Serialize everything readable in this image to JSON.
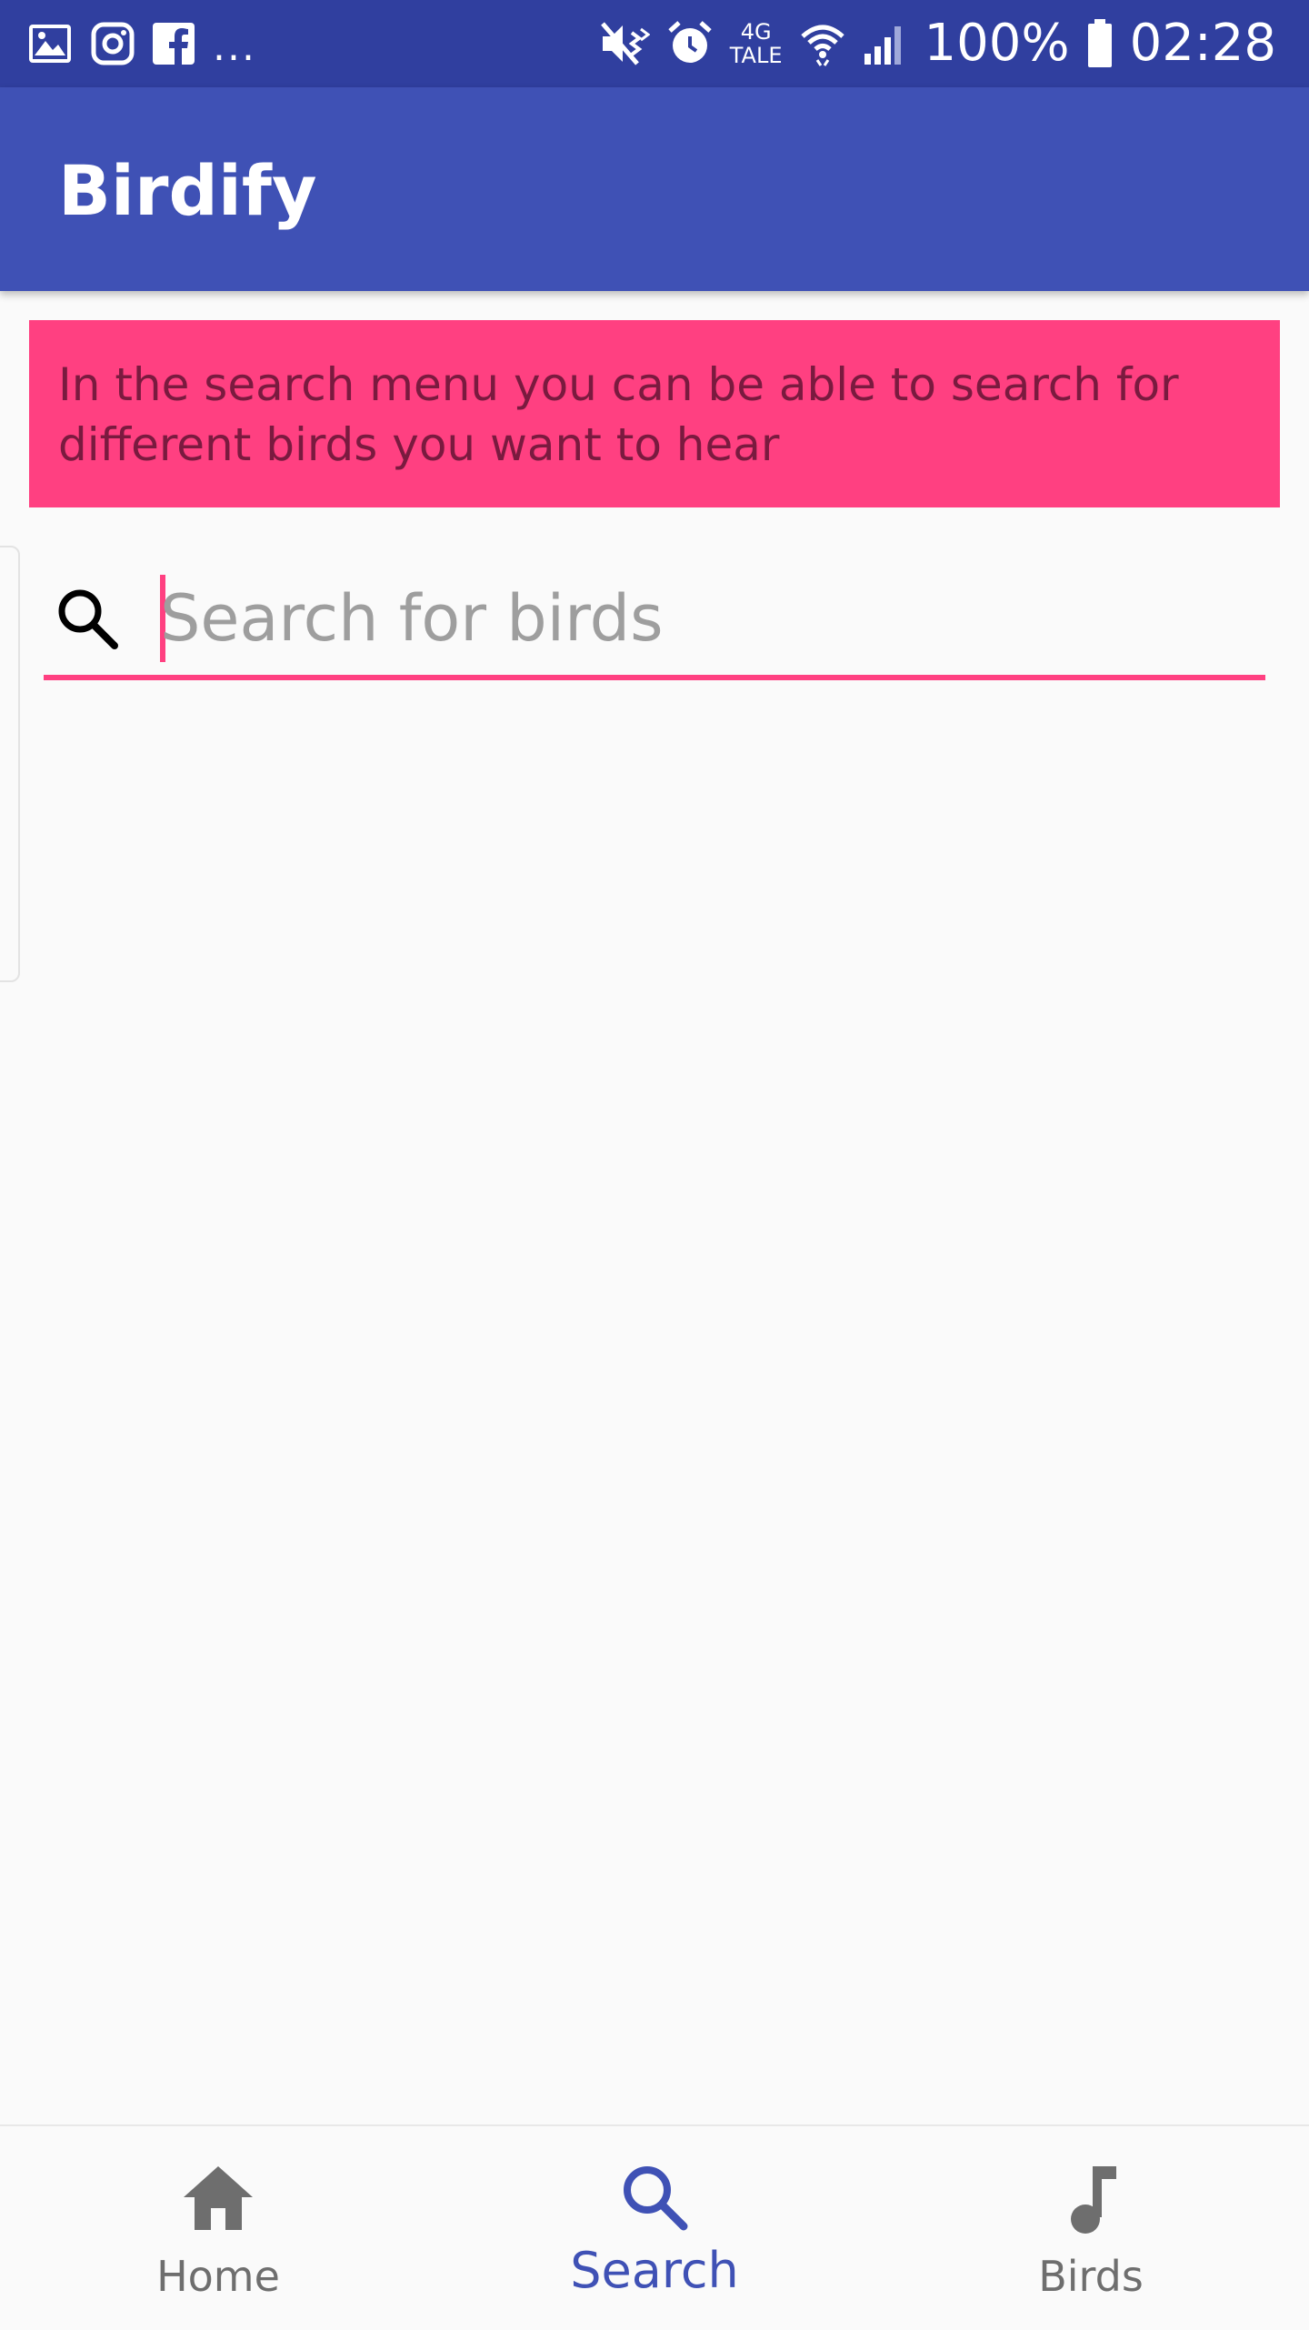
{
  "status_bar": {
    "left_icons": [
      "gallery-icon",
      "instagram-icon",
      "facebook-icon"
    ],
    "more": "...",
    "network_top": "4G",
    "network_bottom": "TALE",
    "battery": "100%",
    "time": "02:28",
    "right_icons": [
      "vibrate-mute-icon",
      "alarm-icon",
      "wifi-icon",
      "signal-icon",
      "battery-icon"
    ]
  },
  "app_bar": {
    "title": "Birdify"
  },
  "banner": {
    "text": "In the search menu you can be able to search for different birds you want to hear"
  },
  "search": {
    "placeholder": "Search for birds",
    "value": ""
  },
  "bottom_nav": {
    "items": [
      {
        "label": "Home",
        "icon": "home-icon",
        "active": false
      },
      {
        "label": "Search",
        "icon": "search-icon",
        "active": true
      },
      {
        "label": "Birds",
        "icon": "music-note-icon",
        "active": false
      }
    ]
  },
  "colors": {
    "status_bar": "#303f9f",
    "app_bar": "#3f51b5",
    "accent": "#ff4081",
    "nav_active": "#3f51b5",
    "nav_inactive": "#6e6e6e",
    "background": "#fafafa"
  }
}
